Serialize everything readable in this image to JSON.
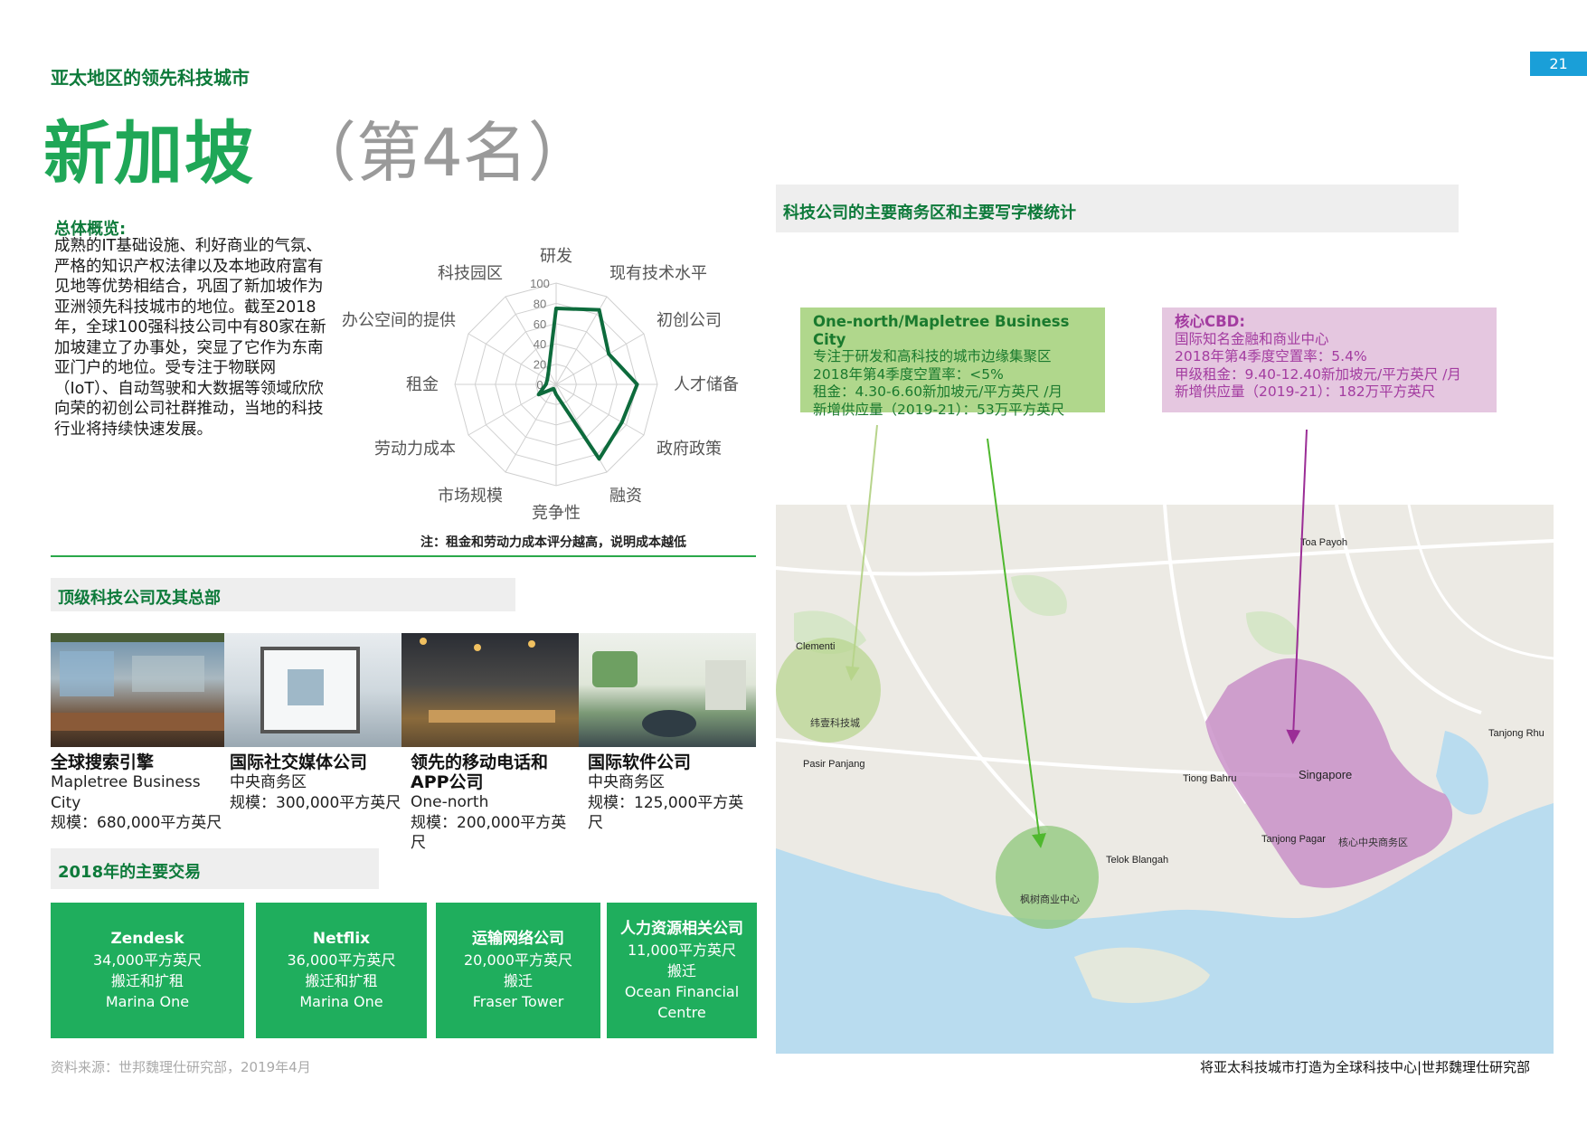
{
  "page_number": "21",
  "header": {
    "kicker": "亚太地区的领先科技城市",
    "title": "新加坡",
    "rank": "（第4名）"
  },
  "overview": {
    "heading": "总体概览:",
    "body": "成熟的IT基础设施、利好商业的气氛、严格的知识产权法律以及本地政府富有见地等优势相结合，巩固了新加坡作为亚洲领先科技城市的地位。截至2018年，全球100强科技公司中有80家在新加坡建立了办事处，突显了它作为东南亚门户的地位。受专注于物联网（IoT）、自动驾驶和大数据等领域欣欣向荣的初创公司社群推动，当地的科技行业将持续快速发展。"
  },
  "chart_data": {
    "type": "radar",
    "axes": [
      "研发",
      "现有技术水平",
      "初创公司",
      "人才储备",
      "政府政策",
      "融资",
      "竞争性",
      "市场规模",
      "劳动力成本",
      "租金",
      "办公空间的提供",
      "科技园区"
    ],
    "values": [
      75,
      85,
      60,
      80,
      75,
      85,
      10,
      5,
      20,
      10,
      10,
      15
    ],
    "scale_ticks": [
      "0",
      "20",
      "40",
      "60",
      "80",
      "100"
    ],
    "range": [
      0,
      100
    ],
    "note": "注：租金和劳动力成本评分越高，说明成本越低",
    "colors": {
      "line": "#0d6b3c",
      "grid": "#d0d0d0"
    }
  },
  "top_companies": {
    "heading": "顶级科技公司及其总部",
    "items": [
      {
        "name": "全球搜索引擎",
        "location": "Mapletree Business City",
        "size": "规模：680,000平方英尺"
      },
      {
        "name": "国际社交媒体公司",
        "location": "中央商务区",
        "size": "规模：300,000平方英尺"
      },
      {
        "name": "领先的移动电话和APP公司",
        "location": "One-north",
        "size": "规模：200,000平方英尺"
      },
      {
        "name": "国际软件公司",
        "location": "中央商务区",
        "size": "规模：125,000平方英尺"
      }
    ]
  },
  "deals": {
    "heading": "2018年的主要交易",
    "items": [
      {
        "name": "Zendesk",
        "size": "34,000平方英尺",
        "type": "搬迁和扩租",
        "building": "Marina One"
      },
      {
        "name": "Netflix",
        "size": "36,000平方英尺",
        "type": "搬迁和扩租",
        "building": "Marina One"
      },
      {
        "name": "运输网络公司",
        "size": "20,000平方英尺",
        "type": "搬迁",
        "building": "Fraser Tower"
      },
      {
        "name": "人力资源相关公司",
        "size": "11,000平方英尺",
        "type": "搬迁",
        "building": "Ocean Financial Centre"
      }
    ]
  },
  "map_section": {
    "heading": "科技公司的主要商务区和主要写字楼统计",
    "one_north": {
      "title": "One-north/Mapletree Business City",
      "line1": "专注于研发和高科技的城市边缘集聚区",
      "line2": "2018年第4季度空置率：<5%",
      "line3": "租金：4.30-6.60新加坡元/平方英尺 /月",
      "line4": "新增供应量（2019-21）：53万平方英尺"
    },
    "cbd": {
      "title": "核心CBD:",
      "line1": "国际知名金融和商业中心",
      "line2": "2018年第4季度空置率：5.4%",
      "line3": "甲级租金：9.40-12.40新加坡元/平方英尺 /月",
      "line4": "新增供应量（2019-21）：182万平方英尺"
    },
    "map_labels": {
      "toa_payoh": "Toa Payoh",
      "clementi": "Clementi",
      "pasir_panjang": "Pasir Panjang",
      "tiong_bahru": "Tiong Bahru",
      "singapore": "Singapore",
      "tanjong_pagar": "Tanjong Pagar",
      "telok_blangah": "Telok Blangah",
      "tanjong_rhu": "Tanjong Rhu",
      "one_north_zone": "纬壹科技城",
      "mapletree_zone": "枫树商业中心",
      "cbd_zone": "核心中央商务区"
    }
  },
  "source": "资料来源：世邦魏理仕研究部，2019年4月",
  "footer": "将亚太科技城市打造为全球科技中心|世邦魏理仕研究部"
}
